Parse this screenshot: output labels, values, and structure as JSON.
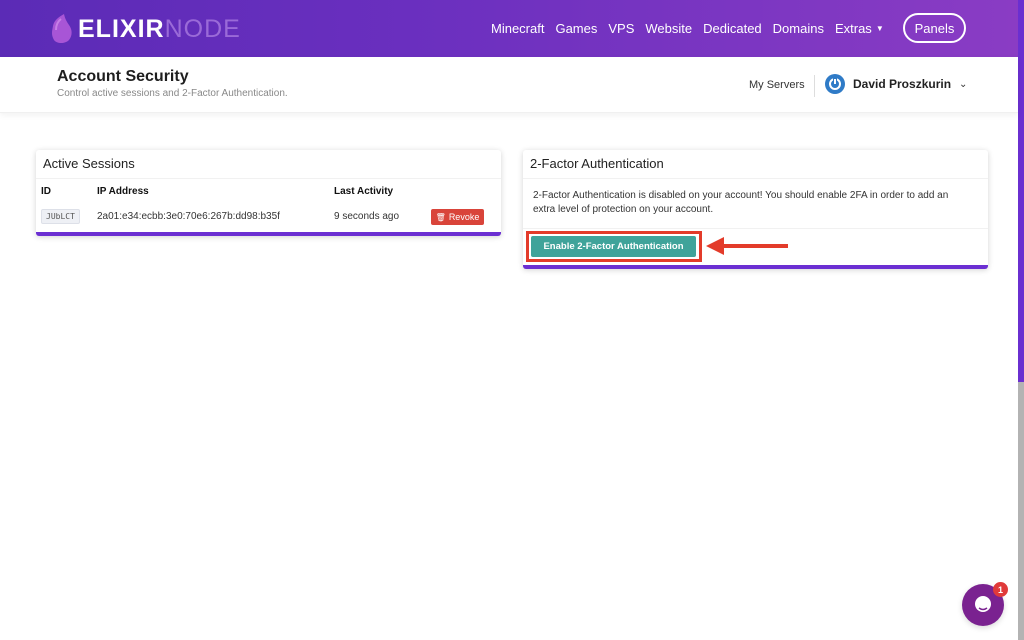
{
  "brand": {
    "name_bold": "ELIXIR",
    "name_light": "NODE"
  },
  "nav": {
    "links": [
      {
        "label": "Minecraft"
      },
      {
        "label": "Games"
      },
      {
        "label": "VPS"
      },
      {
        "label": "Website"
      },
      {
        "label": "Dedicated"
      },
      {
        "label": "Domains"
      },
      {
        "label": "Extras",
        "has_dropdown": true
      }
    ],
    "panels_label": "Panels"
  },
  "header": {
    "title": "Account Security",
    "subtitle": "Control active sessions and 2-Factor Authentication.",
    "my_servers": "My Servers",
    "user_name": "David Proszkurin",
    "user_icon": "power-icon"
  },
  "sessions": {
    "title": "Active Sessions",
    "columns": [
      "ID",
      "IP Address",
      "Last Activity"
    ],
    "rows": [
      {
        "id": "JUbLCT",
        "ip": "2a01:e34:ecbb:3e0:70e6:267b:dd98:b35f",
        "last_activity": "9 seconds ago",
        "action": "Revoke"
      }
    ]
  },
  "twofa": {
    "title": "2-Factor Authentication",
    "message": "2-Factor Authentication is disabled on your account! You should enable 2FA in order to add an extra level of protection on your account.",
    "button_label": "Enable 2-Factor Authentication"
  },
  "chat": {
    "badge_count": "1"
  },
  "colors": {
    "nav_gradient_start": "#5b2bb6",
    "nav_gradient_end": "#8a3cc4",
    "card_accent": "#6b2fd2",
    "revoke": "#d9443a",
    "enable": "#3fa39a",
    "annotation": "#e33b2a",
    "chat": "#7a2290"
  }
}
